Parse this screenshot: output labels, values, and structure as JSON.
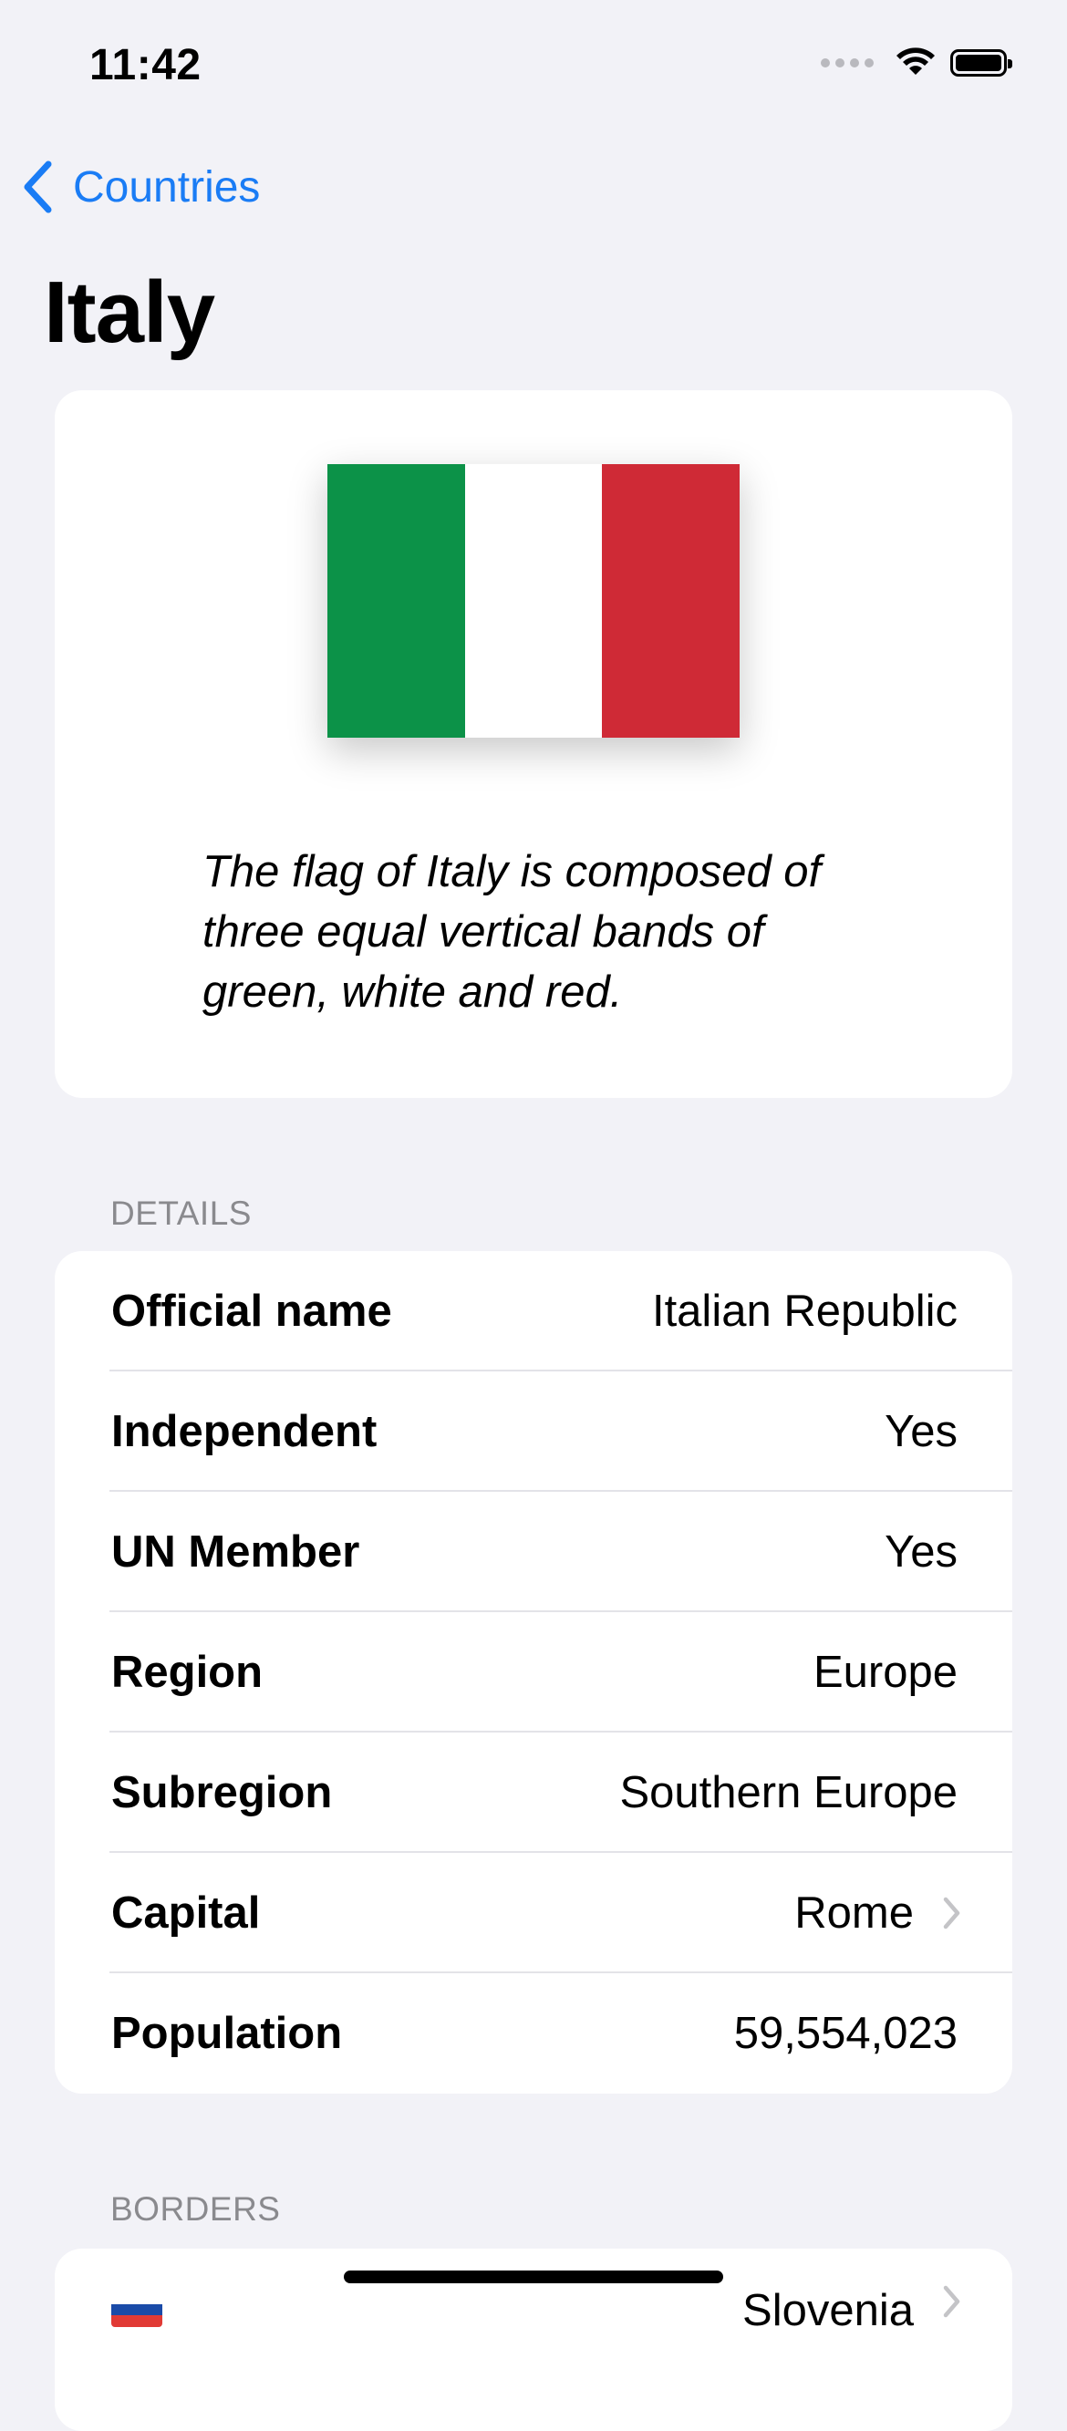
{
  "status_bar": {
    "time": "11:42",
    "icons": [
      "cellular-signal-icon",
      "wifi-icon",
      "battery-icon"
    ]
  },
  "nav": {
    "back_label": "Countries",
    "title": "Italy"
  },
  "flag": {
    "colors": [
      "#0c9248",
      "#ffffff",
      "#cf2a36"
    ],
    "description": "The flag of Italy is composed of three equal vertical bands of green, white and red."
  },
  "details": {
    "header": "DETAILS",
    "rows": [
      {
        "label": "Official name",
        "value": "Italian Republic"
      },
      {
        "label": "Independent",
        "value": "Yes"
      },
      {
        "label": "UN Member",
        "value": "Yes"
      },
      {
        "label": "Region",
        "value": "Europe"
      },
      {
        "label": "Subregion",
        "value": "Southern Europe"
      },
      {
        "label": "Capital",
        "value": "Rome"
      },
      {
        "label": "Population",
        "value": "59,554,023"
      }
    ]
  },
  "borders": {
    "header": "BORDERS",
    "items": [
      {
        "name": "Slovenia",
        "flag_colors": [
          "#ffffff",
          "#1a4ba8",
          "#e13a35"
        ]
      }
    ]
  },
  "colors": {
    "accent": "#1a7cf5",
    "background": "#f2f2f7",
    "card": "#ffffff",
    "secondary_text": "#8a8a8e"
  }
}
